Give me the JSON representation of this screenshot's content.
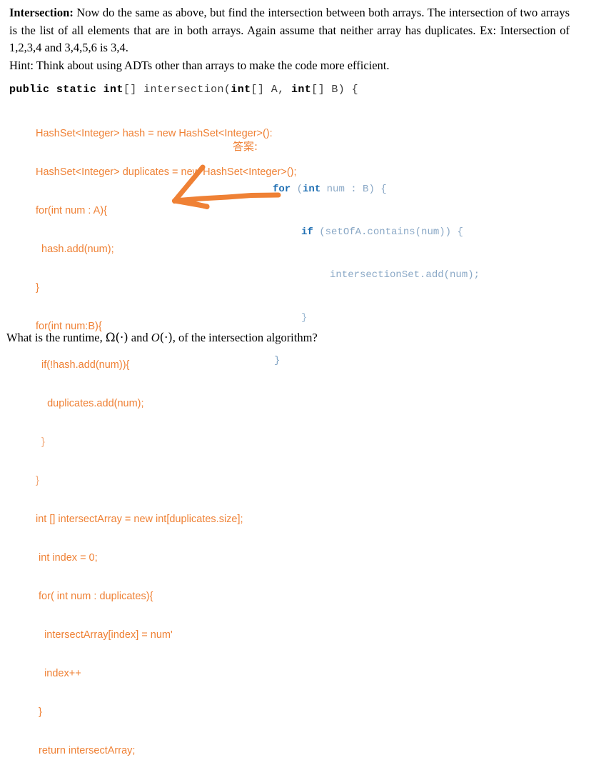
{
  "colors": {
    "student_code_orange": "#ef8135",
    "answer_keyword_blue": "#1f6fb3",
    "answer_body_blue": "#8aa8c6",
    "arrow_orange": "#ef8135",
    "text_black": "#000000",
    "page_background": "#ffffff"
  },
  "problem": {
    "lead_in": "Intersection:",
    "paragraph": " Now do the same as above, but find the intersection between both arrays. The intersection of two arrays is the list of all elements that are in both arrays. Again assume that neither array has duplicates. Ex: Intersection of 1,2,3,4 and 3,4,5,6 is 3,4.",
    "hint": "Hint: Think about using ADTs other than arrays to make the code more efficient."
  },
  "signature": {
    "kw_public": "public",
    "kw_static": "static",
    "kw_int_return": "int",
    "brackets_return": "[]",
    "method_name": " intersection(",
    "kw_int_a": "int",
    "brackets_a": "[]",
    "param_a": " A, ",
    "kw_int_b": "int",
    "brackets_b": "[]",
    "param_b": " B) {",
    "full_text": "public static int[] intersection(int[] A, int[] B) {"
  },
  "student_code": {
    "lines": [
      "HashSet<Integer> hash = new HashSet<Integer>():",
      "HashSet<Integer> duplicates = new HashSet<Integer>();",
      "for(int num : A){",
      "  hash.add(num);",
      "}",
      "for(int num:B){",
      "  if(!hash.add(num)){",
      "    duplicates.add(num);",
      "  }",
      "}",
      "int [] intersectArray = new int[duplicates.size];",
      " int index = 0;",
      " for( int num : duplicates){",
      "   intersectArray[index] = num'",
      "   index++",
      " }",
      " return intersectArray;"
    ]
  },
  "answer_annotation": {
    "label": "答案:",
    "lines": [
      {
        "indent": 0,
        "keyword": "for",
        "rest": " (int num : B) {"
      },
      {
        "indent": 1,
        "keyword": "if",
        "rest": " (setOfA.contains(num)) {"
      },
      {
        "indent": 2,
        "keyword": "",
        "rest": "intersectionSet.add(num);"
      },
      {
        "indent": 1,
        "keyword": "",
        "rest": "}"
      },
      {
        "indent": 0,
        "keyword": "",
        "rest": "}"
      }
    ],
    "line_1_full": "for (int num : B) {",
    "line_2_full": "if (setOfA.contains(num)) {",
    "line_3_full": "intersectionSet.add(num);",
    "line_4_full": "}",
    "line_5_full": "}",
    "kw_for": "for",
    "kw_if": "if",
    "kw_int": "int",
    "after_for": " (",
    "after_int": " num : B) {",
    "after_if": " (setOfA.contains(num)) {"
  },
  "arrow": {
    "name": "hand-drawn-left-arrow",
    "direction": "left",
    "points_to": "if(!hash.add(num)){"
  },
  "runtime_question": {
    "prefix": "What is the runtime, ",
    "omega": "Ω(·)",
    "conjunction": " and ",
    "bigo": "O",
    "bigo_arg": "(·)",
    "suffix": ", of the intersection algorithm?",
    "full_text": "What is the runtime, Ω(·) and O(·), of the intersection algorithm?"
  }
}
